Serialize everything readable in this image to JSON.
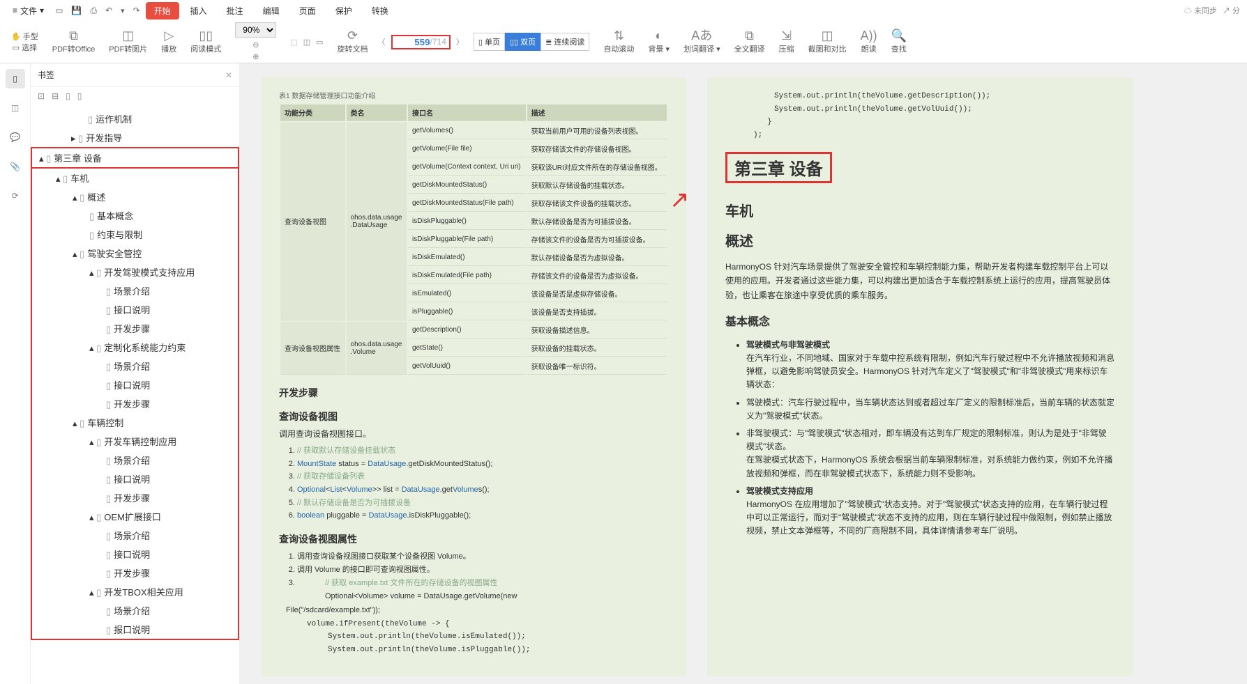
{
  "menu": {
    "file_label": "文件",
    "items": [
      "开始",
      "插入",
      "批注",
      "编辑",
      "页面",
      "保护",
      "转换"
    ],
    "active_index": 0,
    "status": "未同步",
    "share": "分"
  },
  "ribbon": {
    "hand": "手型",
    "select": "选择",
    "pdf_to_office": "PDF转Office",
    "pdf_to_img": "PDF转图片",
    "play": "播放",
    "read_mode": "阅读模式",
    "zoom": "90%",
    "rotate": "旋转文档",
    "page_current": "559",
    "page_total": "/714",
    "view_single": "单页",
    "view_double": "双页",
    "view_scroll": "连续阅读",
    "auto_scroll": "自动滚动",
    "bg": "背景",
    "sel_trans": "划词翻译",
    "full_trans": "全文翻译",
    "compress": "压缩",
    "crop": "截图和对比",
    "read_aloud": "朗读",
    "find": "查找"
  },
  "sidebar": {
    "title": "书签",
    "tools": [
      "展开",
      "折叠",
      "添加",
      "删除"
    ],
    "n_run": "运作机制",
    "n_guide": "开发指导",
    "chap": "第三章 设备",
    "car": "车机",
    "overview": "概述",
    "basic": "基本概念",
    "limit": "约束与限制",
    "drive_safe": "驾驶安全管控",
    "dev_drive": "开发驾驶模式支持应用",
    "scene": "场景介绍",
    "api": "接口说明",
    "steps": "开发步骤",
    "custom_limit": "定制化系统能力约束",
    "car_ctrl": "车辆控制",
    "dev_car_ctrl": "开发车辆控制应用",
    "oem": "OEM扩展接口",
    "tbox": "开发TBOX相关应用",
    "grp_desc": "报口说明"
  },
  "pageL": {
    "table_cap": "表1 数据存储管理接口功能介绍",
    "th": [
      "功能分类",
      "类名",
      "接口名",
      "描述"
    ],
    "g1": "查询设备视图",
    "g1cls": "ohos.data.usage\n.DataUsage",
    "g2": "查询设备视图属性",
    "g2cls": "ohos.data.usage\n.Volume",
    "rows": [
      [
        "getVolumes()",
        "获取当前用户可用的设备列表视图。"
      ],
      [
        "getVolume(File file)",
        "获取存储该文件的存储设备视图。"
      ],
      [
        "getVolume(Context context, Uri uri)",
        "获取该URI对应文件所在的存储设备视图。"
      ],
      [
        "getDiskMountedStatus()",
        "获取默认存储设备的挂载状态。"
      ],
      [
        "getDiskMountedStatus(File path)",
        "获取存储该文件设备的挂载状态。"
      ],
      [
        "isDiskPluggable()",
        "默认存储设备是否为可插拔设备。"
      ],
      [
        "isDiskPluggable(File path)",
        "存储该文件的设备是否为可插拔设备。"
      ],
      [
        "isDiskEmulated()",
        "默认存储设备是否为虚拟设备。"
      ],
      [
        "isDiskEmulated(File path)",
        "存储该文件的设备是否为虚拟设备。"
      ],
      [
        "isEmulated()",
        "该设备是否是虚拟存储设备。"
      ],
      [
        "isPluggable()",
        "该设备是否支持插拔。"
      ]
    ],
    "rows2": [
      [
        "getDescription()",
        "获取设备描述信息。"
      ],
      [
        "getState()",
        "获取设备的挂载状态。"
      ],
      [
        "getVolUuid()",
        "获取设备唯一标识符。"
      ]
    ],
    "dev_steps": "开发步骤",
    "q_view": "查询设备视图",
    "q_view_call": "调用查询设备视图接口。",
    "q_attr": "查询设备视图属性",
    "q_attr_l1": "调用查询设备视图接口获取某个设备视图 Volume。",
    "q_attr_l2": "调用 Volume 的接口即可查询视图属性。",
    "code1": [
      "// 获取默认存储设备挂载状态",
      "MountState status = DataUsage.getDiskMountedStatus();",
      "// 获取存储设备列表",
      "Optional<List<Volume>> list = DataUsage.getVolumes();",
      "// 默认存储设备是否为可插拔设备",
      "boolean pluggable = DataUsage.isDiskPluggable();"
    ],
    "code3_1": "// 获取 example.txt 文件所在的存储设备的视图属性",
    "code3_2": "Optional<Volume>   volume   =    DataUsage.getVolume(new",
    "code3_3": "File(\"/sdcard/example.txt\"));",
    "code3_4": "volume.ifPresent(theVolume -> {",
    "code3_5": "System.out.println(theVolume.isEmulated());",
    "code3_6": "System.out.println(theVolume.isPluggable());"
  },
  "pageR": {
    "code1": "System.out.println(theVolume.getDescription());",
    "code2": "System.out.println(theVolume.getVolUuid());",
    "code3": "}",
    "code4": ");",
    "chapter": "第三章 设备",
    "h_car": "车机",
    "h_over": "概述",
    "p1": "HarmonyOS 针对汽车场景提供了驾驶安全管控和车辆控制能力集，帮助开发者构建车载控制平台上可以使用的应用。开发者通过这些能力集，可以构建出更加适合于车载控制系统上运行的应用，提高驾驶员体验，也让乘客在旅途中享受优质的乘车服务。",
    "h_basic": "基本概念",
    "b1_t": "驾驶模式与非驾驶模式",
    "b1": "在汽车行业，不同地域、国家对于车载中控系统有限制，例如汽车行驶过程中不允许播放视频和消息弹框，以避免影响驾驶员安全。HarmonyOS 针对汽车定义了\"驾驶模式\"和\"非驾驶模式\"用来标识车辆状态：",
    "b2": "驾驶模式：汽车行驶过程中，当车辆状态达到或者超过车厂定义的限制标准后，当前车辆的状态就定义为\"驾驶模式\"状态。",
    "b3": "非驾驶模式：与\"驾驶模式\"状态相对，即车辆没有达到车厂规定的限制标准，则认为是处于\"非驾驶模式\"状态。",
    "b3b": "在驾驶模式状态下，HarmonyOS 系统会根据当前车辆限制标准，对系统能力做约束，例如不允许播放视频和弹框，而在非驾驶模式状态下，系统能力则不受影响。",
    "b4_t": "驾驶模式支持应用",
    "b4": "HarmonyOS 在应用增加了\"驾驶模式\"状态支持。对于\"驾驶模式\"状态支持的应用，在车辆行驶过程中可以正常运行，而对于\"驾驶模式\"状态不支持的应用，则在车辆行驶过程中做限制，例如禁止播放视频，禁止文本弹框等，不同的厂商限制不同，具体详情请参考车厂说明。"
  }
}
